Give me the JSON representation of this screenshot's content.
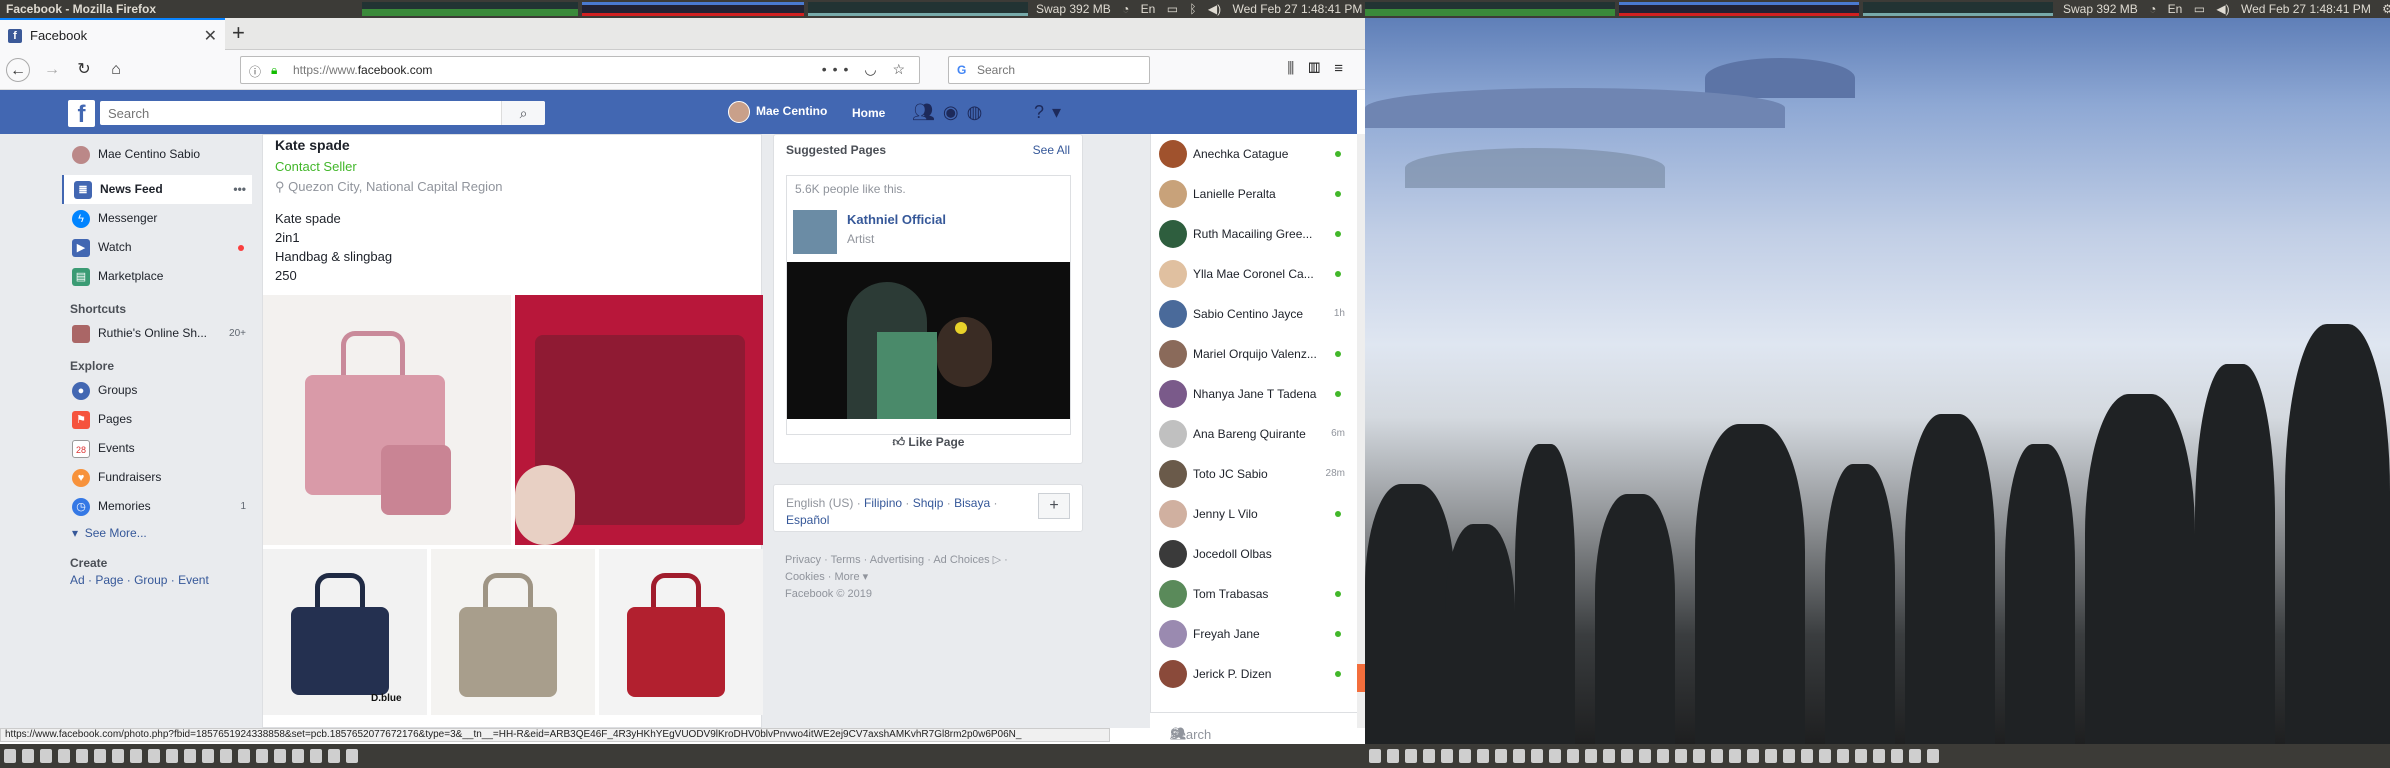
{
  "left_panel": {
    "title": "Facebook - Mozilla Firefox",
    "swap": "Swap 392 MB",
    "clock": "Wed Feb 27  1:48:41 PM"
  },
  "right_panel": {
    "swap": "Swap 392 MB",
    "clock": "Wed Feb 27  1:48:41 PM"
  },
  "browser": {
    "tab_title": "Facebook",
    "url_prefix": "https://www.",
    "url_domain": "facebook.com",
    "search_placeholder": "Search",
    "status_url": "https://www.facebook.com/photo.php?fbid=1857651924338858&set=pcb.1857652077672176&type=3&__tn__=HH-R&eid=ARB3QE46F_4R3yHKhYEgVUODV9lKroDHV0blvPnvwo4itWE2ej9CV7axshAMKvhR7Gl8rm2p0w6P06N_"
  },
  "fb": {
    "search_placeholder": "Search",
    "user_name": "Mae Centino",
    "home": "Home"
  },
  "leftnav": {
    "profile": "Mae Centino Sabio",
    "items": [
      {
        "label": "News Feed",
        "extra": "•••"
      },
      {
        "label": "Messenger"
      },
      {
        "label": "Watch"
      },
      {
        "label": "Marketplace"
      }
    ],
    "shortcuts_title": "Shortcuts",
    "shortcut": {
      "label": "Ruthie's Online Sh...",
      "count": "20+"
    },
    "explore_title": "Explore",
    "explore": [
      {
        "label": "Groups"
      },
      {
        "label": "Pages"
      },
      {
        "label": "Events"
      },
      {
        "label": "Fundraisers"
      },
      {
        "label": "Memories",
        "count": "1"
      }
    ],
    "see_more": "See More...",
    "create_title": "Create",
    "create_links": [
      "Ad",
      "Page",
      "Group",
      "Event"
    ]
  },
  "post": {
    "title": "Kate spade",
    "contact": "Contact Seller",
    "location": "Quezon City, National Capital Region",
    "lines": [
      "Kate spade",
      "2in1",
      "Handbag & slingbag",
      "250"
    ],
    "caption": "D.blue"
  },
  "suggested": {
    "header": "Suggested Pages",
    "see_all": "See All",
    "likes": "5.6K people like this.",
    "page_name": "Kathniel Official",
    "page_category": "Artist",
    "like_button": "Like Page"
  },
  "languages": {
    "current": "English (US)",
    "others": [
      "Filipino",
      "Shqip",
      "Bisaya",
      "Español"
    ]
  },
  "footer": {
    "line1": "Privacy · Terms · Advertising · Ad Choices ▷ ·",
    "line2": "Cookies · More ▾",
    "line3": "Facebook © 2019"
  },
  "chat": {
    "contacts": [
      {
        "name": "Anechka Catague",
        "status": "online",
        "color": "#a0522d"
      },
      {
        "name": "Lanielle Peralta",
        "status": "online",
        "color": "#c8a27a"
      },
      {
        "name": "Ruth Macailing Gree...",
        "status": "online",
        "color": "#2e5e3e"
      },
      {
        "name": "Ylla Mae Coronel Ca...",
        "status": "online",
        "color": "#e0c0a0"
      },
      {
        "name": "Sabio Centino Jayce",
        "status": "1h",
        "color": "#4a6a9a"
      },
      {
        "name": "Mariel Orquijo Valenz...",
        "status": "online",
        "color": "#8a6a5a"
      },
      {
        "name": "Nhanya Jane T Tadena",
        "status": "online",
        "color": "#7a5a8a"
      },
      {
        "name": "Ana Bareng Quirante",
        "status": "6m",
        "color": "#c0c0c0"
      },
      {
        "name": "Toto JC Sabio",
        "status": "28m",
        "color": "#6a5a4a"
      },
      {
        "name": "Jenny L Vilo",
        "status": "online",
        "color": "#d0b0a0"
      },
      {
        "name": "Jocedoll Olbas",
        "status": "",
        "color": "#3a3a3a"
      },
      {
        "name": "Tom Trabasas",
        "status": "online",
        "color": "#5a8a5a"
      },
      {
        "name": "Freyah Jane",
        "status": "online",
        "color": "#9a8ab0"
      },
      {
        "name": "Jerick P. Dizen",
        "status": "online",
        "color": "#8a4a3a"
      }
    ],
    "search_placeholder": "Search"
  },
  "colors": {
    "fb_blue": "#4267b2",
    "link": "#365899",
    "online": "#42b72a"
  }
}
